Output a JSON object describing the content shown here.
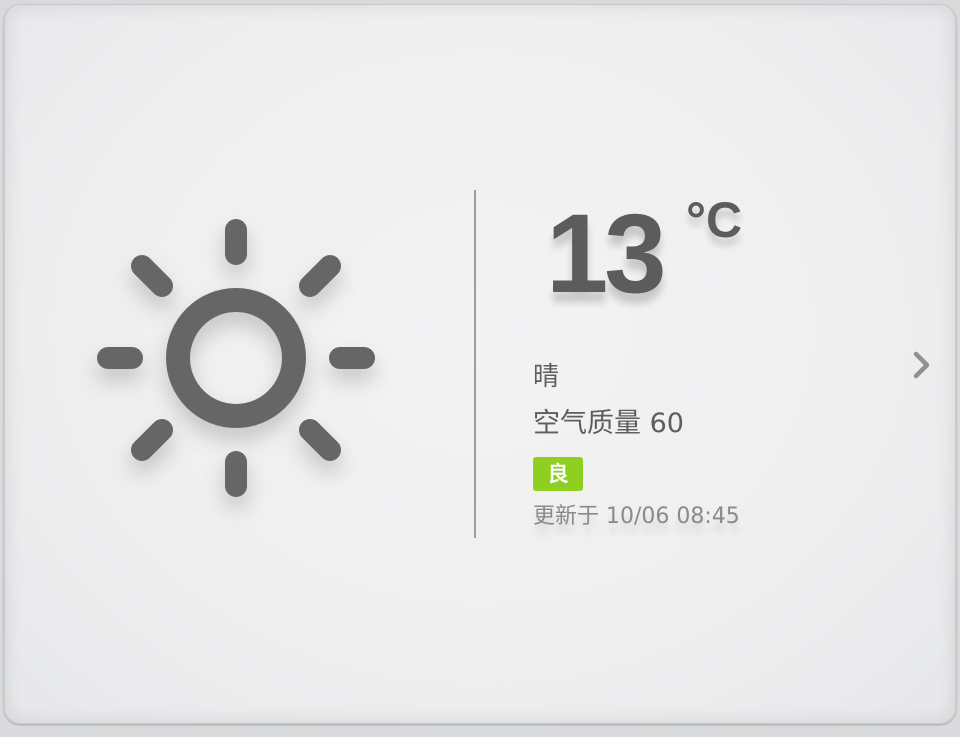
{
  "weather": {
    "icon": "sun-icon",
    "temperature": "13",
    "unit": "°C",
    "condition": "晴",
    "air_quality": "空气质量 60",
    "air_quality_level": "良",
    "updated": "更新于 10/06 08:45",
    "next_icon": "chevron-right-icon"
  },
  "colors": {
    "icon": "#666666",
    "text": "#5c5c5d",
    "badge": "#8fcf1f",
    "divider": "#9c9d9f"
  }
}
